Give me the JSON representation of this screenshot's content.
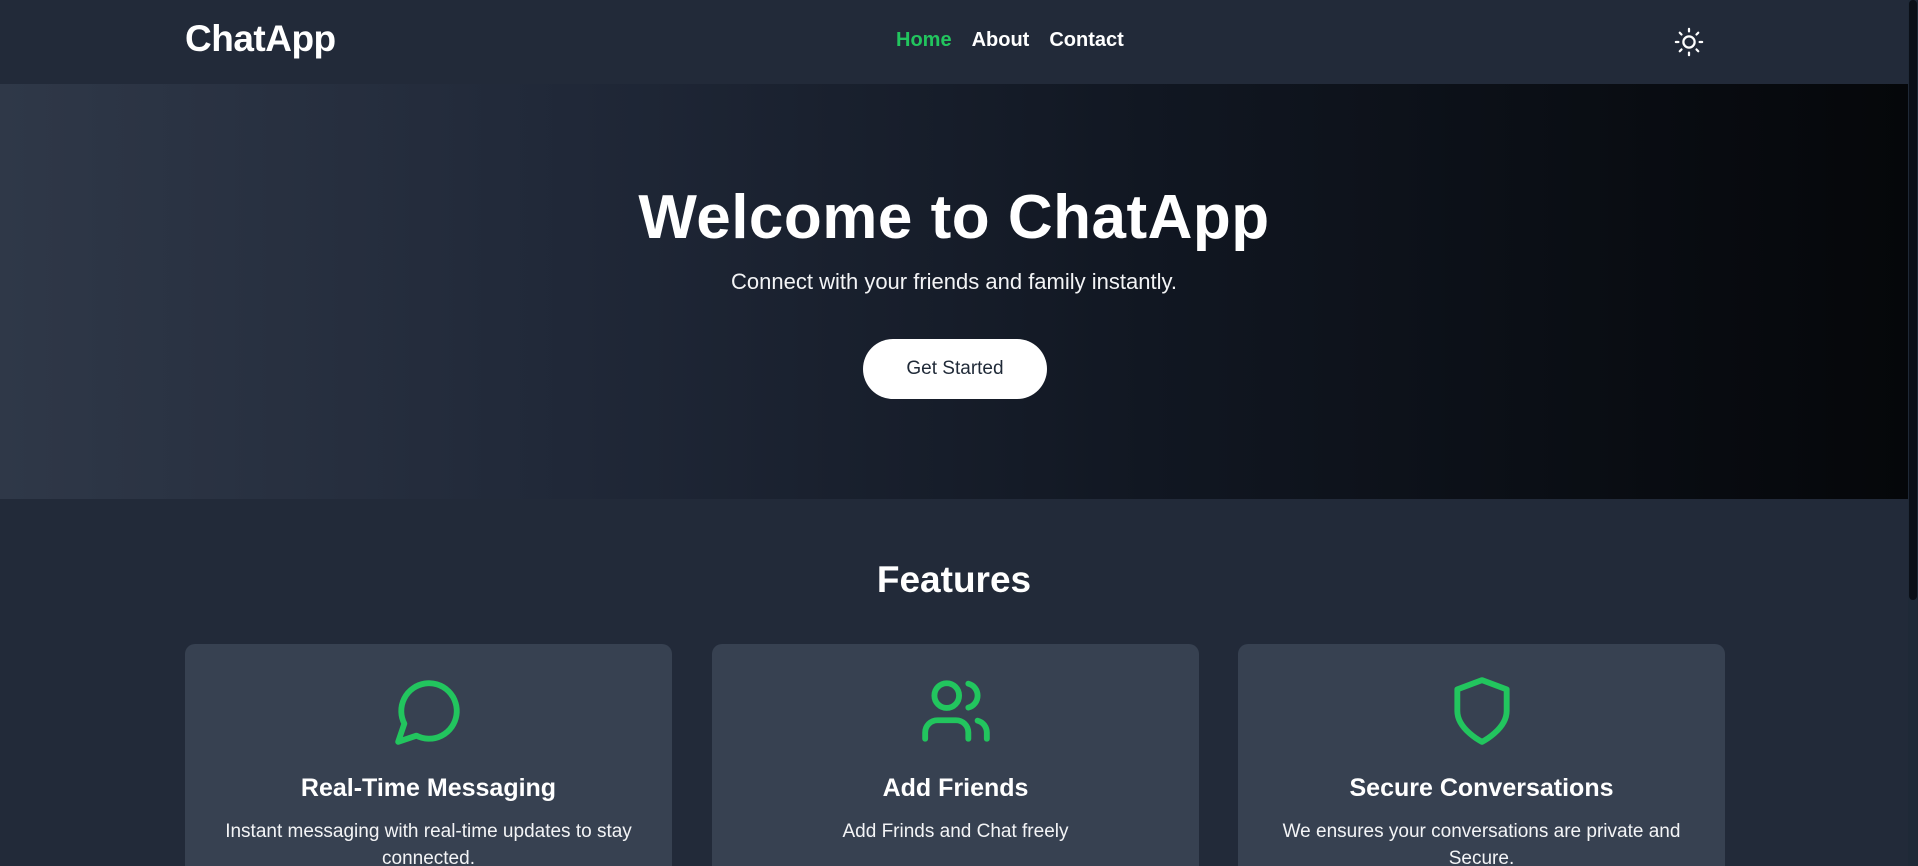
{
  "brand": "ChatApp",
  "nav": {
    "home": "Home",
    "about": "About",
    "contact": "Contact"
  },
  "theme_toggle_icon": "sun-icon",
  "hero": {
    "title": "Welcome to ChatApp",
    "subtitle": "Connect with your friends and family instantly.",
    "cta": "Get Started"
  },
  "features": {
    "title": "Features",
    "cards": [
      {
        "icon": "message-circle-icon",
        "title": "Real-Time Messaging",
        "description": "Instant messaging with real-time updates to stay connected."
      },
      {
        "icon": "users-icon",
        "title": "Add Friends",
        "description": "Add Frinds and Chat freely"
      },
      {
        "icon": "shield-icon",
        "title": "Secure Conversations",
        "description": "We ensures your conversations are private and Secure."
      }
    ]
  },
  "colors": {
    "accent": "#22c55e",
    "navbar_bg": "#222a39",
    "card_bg": "#374151"
  }
}
